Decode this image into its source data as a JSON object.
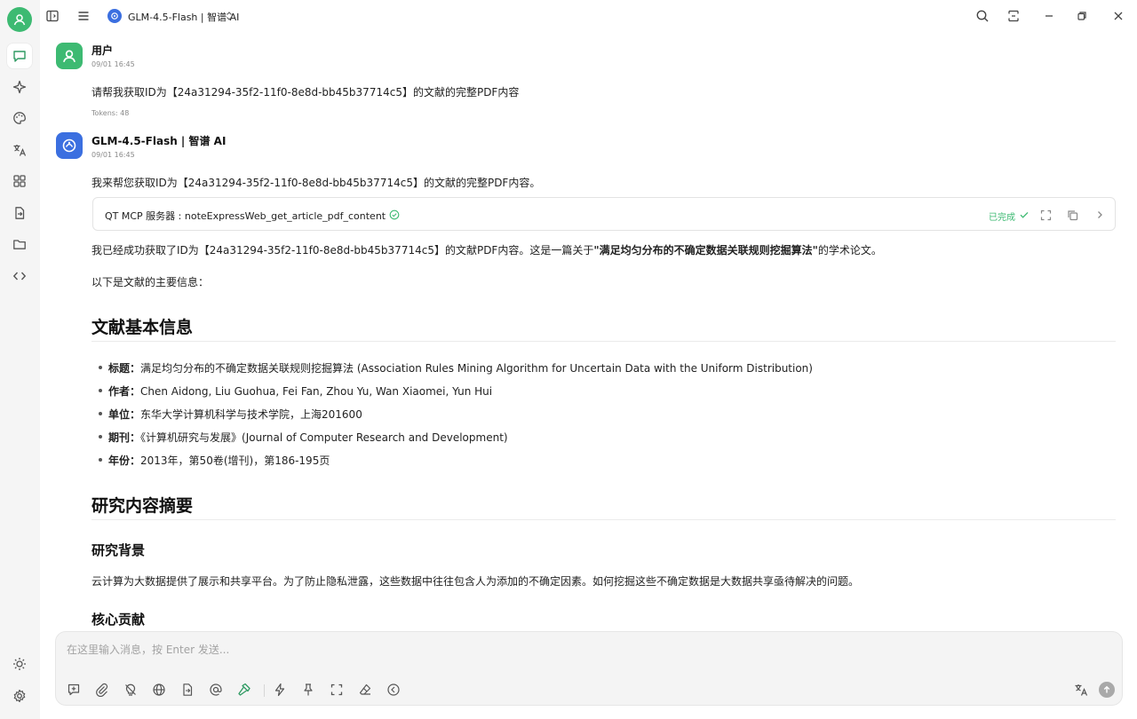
{
  "app": {
    "model_name": "GLM-4.5-Flash | 智谱 AI"
  },
  "icons": {
    "rail": [
      "user-avatar-icon",
      "chat-icon",
      "sparkle-icon",
      "palette-icon",
      "translate-icon",
      "apps-grid-icon",
      "document-transfer-icon",
      "folder-icon",
      "code-icon",
      "sun-icon",
      "settings-gear-icon"
    ],
    "titlebar": [
      "sidebar-toggle-icon",
      "menu-icon",
      "search-icon",
      "split-view-icon",
      "minimize-icon",
      "restore-icon",
      "close-icon"
    ],
    "composer": [
      "new-topic-icon",
      "attachment-icon",
      "no-lightbulb-icon",
      "globe-icon",
      "file-icon",
      "at-mention-icon",
      "hammer-tool-icon",
      "lightning-icon",
      "pin-icon",
      "fullscreen-icon",
      "eraser-icon",
      "back-circle-icon",
      "translate-icon",
      "send-arrow-icon"
    ]
  },
  "colors": {
    "accent_green": "#3dba72",
    "model_blue": "#3b6fe0",
    "status_green": "#3dba72"
  },
  "user_msg": {
    "sender": "用户",
    "time": "09/01 16:45",
    "text": "请帮我获取ID为【24a31294-35f2-11f0-8e8d-bb45b37714c5】的文献的完整PDF内容",
    "tokens": "Tokens: 48"
  },
  "bot_msg": {
    "sender": "GLM-4.5-Flash | 智谱 AI",
    "time": "09/01 16:45",
    "intro": "我来帮您获取ID为【24a31294-35f2-11f0-8e8d-bb45b37714c5】的文献的完整PDF内容。",
    "tool_call": {
      "title": "QT MCP 服务器 : noteExpressWeb_get_article_pdf_content",
      "status": "已完成"
    },
    "result_before": "我已经成功获取了ID为【24a31294-35f2-11f0-8e8d-bb45b37714c5】的文献PDF内容。这是一篇关于",
    "result_bold": "\"满足均匀分布的不确定数据关联规则挖掘算法\"",
    "result_after": "的学术论文。",
    "lead": "以下是文献的主要信息：",
    "section1_title": "文献基本信息",
    "info": [
      {
        "key": "标题：",
        "value": "满足均匀分布的不确定数据关联规则挖掘算法 (Association Rules Mining Algorithm for Uncertain Data with the Uniform Distribution)"
      },
      {
        "key": "作者：",
        "value": "Chen Aidong, Liu Guohua, Fei Fan, Zhou Yu, Wan Xiaomei, Yun Hui"
      },
      {
        "key": "单位：",
        "value": "东华大学计算机科学与技术学院，上海201600"
      },
      {
        "key": "期刊：",
        "value": "《计算机研究与发展》(Journal of Computer Research and Development)"
      },
      {
        "key": "年份：",
        "value": "2013年，第50卷(增刊)，第186-195页"
      }
    ],
    "section2_title": "研究内容摘要",
    "sub1_title": "研究背景",
    "sub1_text": "云计算为大数据提供了展示和共享平台。为了防止隐私泄露，这些数据中往往包含人为添加的不确定因素。如何挖掘这些不确定数据是大数据共享亟待解决的问题。",
    "sub2_title": "核心贡献"
  },
  "composer": {
    "placeholder": "在这里输入消息，按 Enter 发送..."
  }
}
